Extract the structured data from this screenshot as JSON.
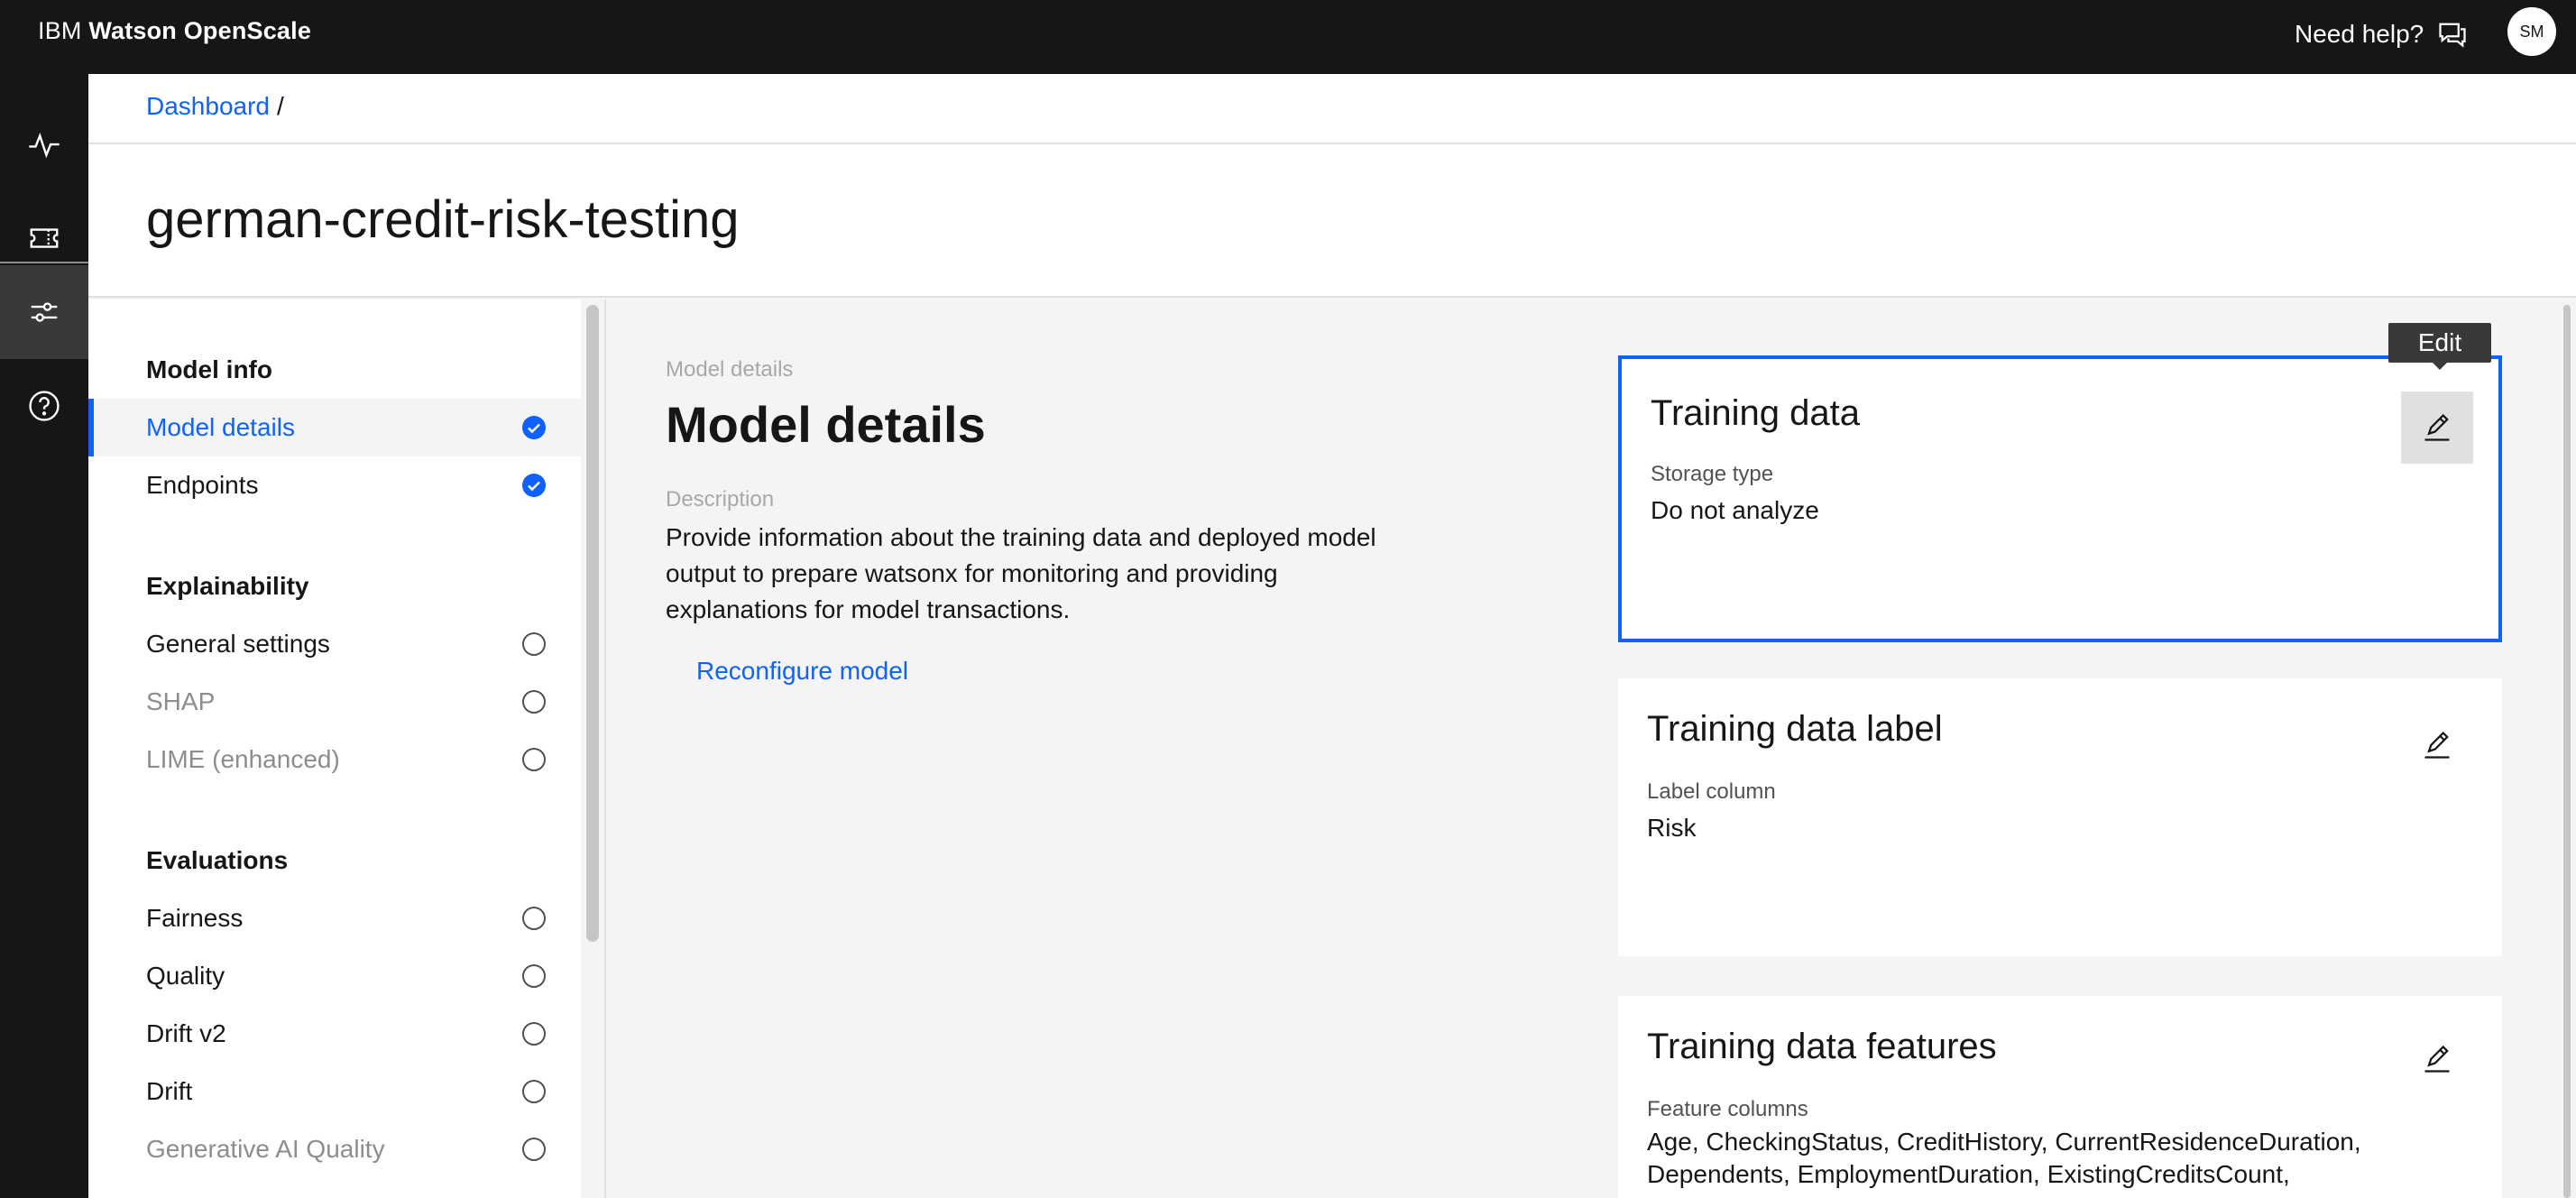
{
  "header": {
    "brand_prefix": "IBM",
    "brand_name": "Watson OpenScale",
    "help_label": "Need help?",
    "avatar_initials": "SM"
  },
  "rail": {
    "items": [
      {
        "icon": "activity-icon"
      },
      {
        "icon": "ticket-icon"
      },
      {
        "icon": "settings-adjust-icon",
        "active": true
      },
      {
        "icon": "help-icon"
      }
    ]
  },
  "breadcrumb": {
    "link": "Dashboard",
    "separator": "/"
  },
  "page": {
    "title": "german-credit-risk-testing"
  },
  "sidenav": {
    "sections": [
      {
        "title": "Model info",
        "items": [
          {
            "label": "Model details",
            "status": "complete",
            "active": true
          },
          {
            "label": "Endpoints",
            "status": "complete"
          }
        ]
      },
      {
        "title": "Explainability",
        "items": [
          {
            "label": "General settings",
            "status": "incomplete"
          },
          {
            "label": "SHAP",
            "status": "incomplete",
            "disabled": true
          },
          {
            "label": "LIME (enhanced)",
            "status": "incomplete",
            "disabled": true
          }
        ]
      },
      {
        "title": "Evaluations",
        "items": [
          {
            "label": "Fairness",
            "status": "incomplete"
          },
          {
            "label": "Quality",
            "status": "incomplete"
          },
          {
            "label": "Drift v2",
            "status": "incomplete"
          },
          {
            "label": "Drift",
            "status": "incomplete"
          },
          {
            "label": "Generative AI Quality",
            "status": "incomplete",
            "disabled": true
          }
        ]
      }
    ]
  },
  "main": {
    "eyebrow": "Model details",
    "title": "Model details",
    "description_label": "Description",
    "description": "Provide information about the training data and deployed model output to prepare watsonx for monitoring and providing explanations for model transactions.",
    "reconfigure_label": "Reconfigure model",
    "tooltip": "Edit",
    "cards": [
      {
        "title": "Training data",
        "field_label": "Storage type",
        "field_value": "Do not analyze"
      },
      {
        "title": "Training data label",
        "field_label": "Label column",
        "field_value": "Risk"
      },
      {
        "title": "Training data features",
        "field_label": "Feature columns",
        "field_value": "Age, CheckingStatus, CreditHistory, CurrentResidenceDuration, Dependents, EmploymentDuration, ExistingCreditsCount,"
      }
    ]
  },
  "colors": {
    "accent": "#0f62fe",
    "header_bg": "#161616",
    "rail_active": "#393939"
  }
}
